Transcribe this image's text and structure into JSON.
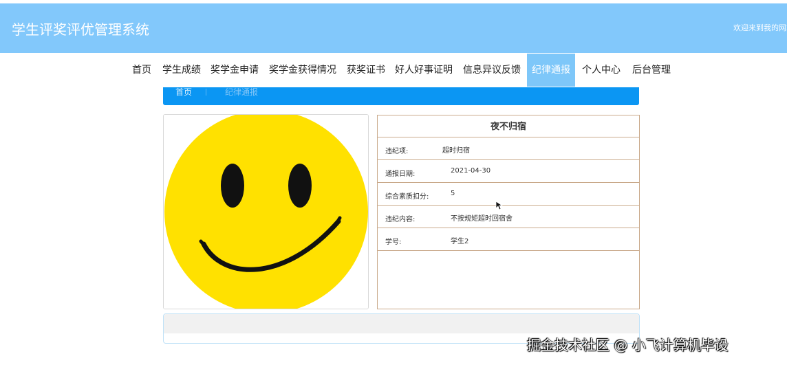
{
  "header": {
    "app_title": "学生评奖评优管理系统",
    "welcome_text": "欢迎来到我的网站"
  },
  "nav": {
    "items": [
      {
        "label": "首页"
      },
      {
        "label": "学生成绩"
      },
      {
        "label": "奖学金申请"
      },
      {
        "label": "奖学金获得情况"
      },
      {
        "label": "获奖证书"
      },
      {
        "label": "好人好事证明"
      },
      {
        "label": "信息异议反馈"
      },
      {
        "label": "纪律通报"
      },
      {
        "label": "个人中心"
      },
      {
        "label": "后台管理"
      }
    ],
    "active_label": "纪律通报"
  },
  "breadcrumb": {
    "home": "首页",
    "current": "纪律通报"
  },
  "image": {
    "icon": "smiley-face"
  },
  "detail": {
    "title": "夜不归宿",
    "rows": [
      {
        "label": "违纪项:",
        "value": "超时归宿"
      },
      {
        "label": "通报日期:",
        "value": "2021-04-30"
      },
      {
        "label": "综合素质扣分:",
        "value": "5"
      },
      {
        "label": "违纪内容:",
        "value": "不按规矩超时回宿舍"
      },
      {
        "label": "学号:",
        "value": "学生2"
      }
    ]
  },
  "watermark": "掘金技术社区 @ 小飞计算机毕设",
  "colors": {
    "header_bg": "#82c8fb",
    "nav_active_bg": "#7ec7f9",
    "breadcrumb_bg": "#0b96f3",
    "detail_border": "#c9a98a",
    "smiley_yellow": "#ffe100"
  }
}
